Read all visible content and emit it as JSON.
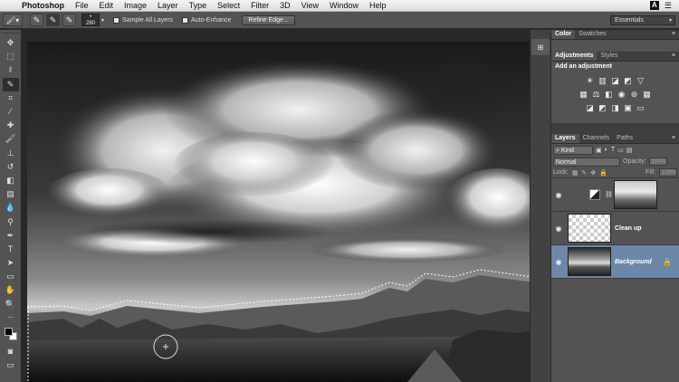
{
  "menubar": {
    "app": "Photoshop",
    "items": [
      "File",
      "Edit",
      "Image",
      "Layer",
      "Type",
      "Select",
      "Filter",
      "3D",
      "View",
      "Window",
      "Help"
    ],
    "right_label": "A"
  },
  "options": {
    "brush_size": "280",
    "sample_all_layers": "Sample All Layers",
    "auto_enhance": "Auto-Enhance",
    "refine_edge": "Refine Edge...",
    "workspace": "Essentials"
  },
  "color_panel": {
    "tabs": [
      "Color",
      "Swatches"
    ]
  },
  "adjustments": {
    "tabs": [
      "Adjustments",
      "Styles"
    ],
    "title": "Add an adjustment"
  },
  "layers_panel": {
    "tabs": [
      "Layers",
      "Channels",
      "Paths"
    ],
    "kind": "Kind",
    "blend_mode": "Normal",
    "opacity_label": "Opacity:",
    "opacity_value": "100%",
    "lock_label": "Lock:",
    "fill_label": "Fill:",
    "fill_value": "100%",
    "layers": [
      {
        "name": "",
        "type": "adjustment"
      },
      {
        "name": "Clean up",
        "type": "empty"
      },
      {
        "name": "Background",
        "type": "photo",
        "selected": true
      }
    ]
  },
  "colors": {
    "selection_blue": "#6d87a8",
    "panel_bg": "#535353",
    "canvas_bg": "#282828"
  }
}
